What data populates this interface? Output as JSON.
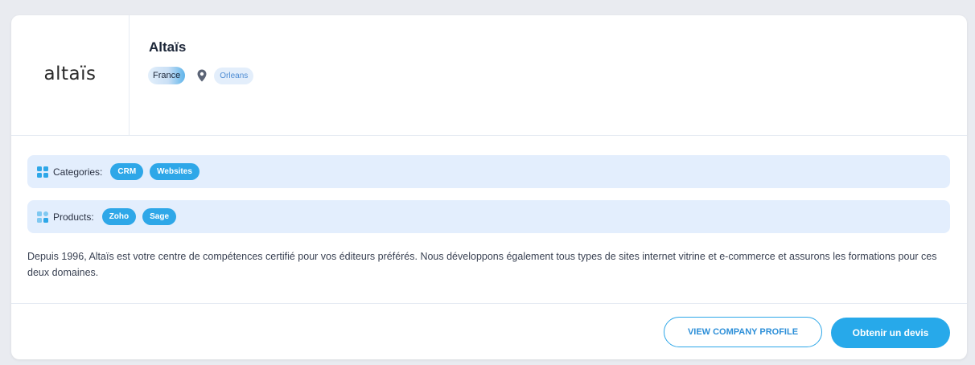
{
  "company": {
    "logo_text": "altaïs",
    "name": "Altaïs",
    "country": "France",
    "city": "Orleans"
  },
  "categories": {
    "label": "Categories:",
    "icon": "grid-icon",
    "tags": [
      "CRM",
      "Websites"
    ]
  },
  "products": {
    "label": "Products:",
    "icon": "products-icon",
    "tags": [
      "Zoho",
      "Sage"
    ]
  },
  "description": "Depuis 1996, Altaïs est votre centre de compétences certifié pour vos éditeurs préférés. Nous développons également tous types de sites internet vitrine et e-commerce et assurons les formations pour ces deux domaines.",
  "actions": {
    "view_profile": "VIEW COMPANY PROFILE",
    "quote": "Obtenir un devis"
  },
  "colors": {
    "accent": "#2ea7e8",
    "band_bg": "#e3eefd",
    "text_dark": "#1c2638"
  }
}
